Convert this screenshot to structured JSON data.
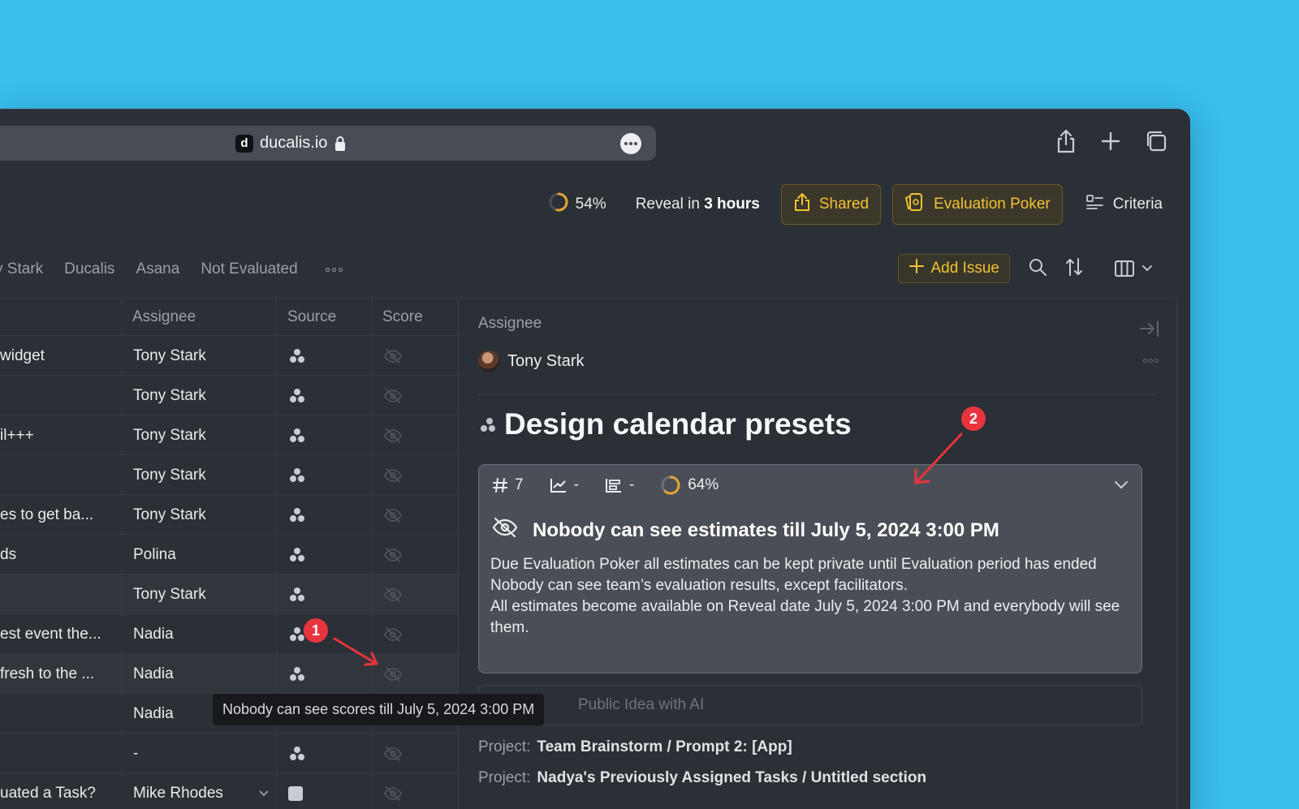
{
  "browser": {
    "favicon_letter": "d",
    "url": "ducalis.io"
  },
  "toolbar": {
    "progress": "54%",
    "reveal_prefix": "Reveal in",
    "reveal_time": "3 hours",
    "shared_label": "Shared",
    "poker_label": "Evaluation Poker",
    "criteria_label": "Criteria"
  },
  "tabs": [
    "y Stark",
    "Ducalis",
    "Asana",
    "Not Evaluated"
  ],
  "actions": {
    "add_issue_label": "Add Issue"
  },
  "table": {
    "headers": {
      "assignee": "Assignee",
      "source": "Source",
      "score": "Score"
    },
    "rows": [
      {
        "title": " widget",
        "assignee": "Tony Stark"
      },
      {
        "title": "",
        "assignee": "Tony Stark"
      },
      {
        "title": "il+++",
        "assignee": "Tony Stark"
      },
      {
        "title": "",
        "assignee": "Tony Stark"
      },
      {
        "title": "es to get ba...",
        "assignee": "Tony Stark"
      },
      {
        "title": "ds",
        "assignee": "Polina"
      },
      {
        "title": "",
        "assignee": "Tony Stark"
      },
      {
        "title": "est event the...",
        "assignee": "Nadia"
      },
      {
        "title": "fresh to the ...",
        "assignee": "Nadia"
      },
      {
        "title": "",
        "assignee": "Nadia"
      },
      {
        "title": "",
        "assignee": "-"
      },
      {
        "title": "uated a Task?",
        "assignee": "Mike Rhodes"
      }
    ]
  },
  "tooltip": "Nobody can see scores till July 5, 2024 3:00 PM",
  "panel": {
    "assignee_label": "Assignee",
    "assignee_name": "Tony Stark",
    "title": "Design calendar presets",
    "estimates": {
      "number": "7",
      "impact": "-",
      "effort": "-",
      "progress": "64%",
      "heading": "Nobody can see estimates till July 5, 2024 3:00 PM",
      "line1": "Due Evaluation Poker all estimates can be kept private until Evaluation period has ended",
      "line2": "Nobody can see team’s evaluation results, except facilitators.",
      "line3": "All estimates become available on Reveal date July 5, 2024 3:00 PM and everybody will see them."
    },
    "ai_text": "Public Idea with AI",
    "project_label": "Project:",
    "project1": "Team Brainstorm / Prompt 2: [App]",
    "project2": "Nadya's Previously Assigned Tasks / Untitled section"
  },
  "annotations": {
    "badge1": "1",
    "badge2": "2"
  },
  "colors": {
    "background": "#38bdec",
    "accent": "#f2c230",
    "badge": "#e8343e"
  },
  "icons": [
    "share-icon",
    "plus-icon",
    "tabs-icon",
    "lock-icon",
    "more-icon",
    "shared-upload-icon",
    "poker-card-icon",
    "criteria-icon",
    "search-icon",
    "sort-icon",
    "columns-icon",
    "source-icon",
    "hidden-score-icon",
    "eye-slash-icon",
    "hash-icon",
    "chart-icon",
    "effort-icon",
    "chevron-down-icon",
    "collapse-panel-icon"
  ]
}
